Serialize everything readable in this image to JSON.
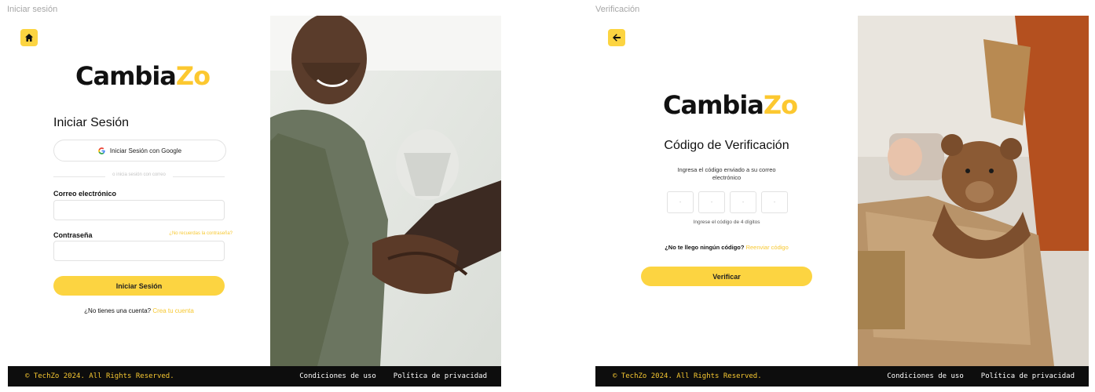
{
  "frames": [
    {
      "label": "Iniciar sesión",
      "logo_main": "Cambia",
      "logo_accent": "Zo",
      "heading": "Iniciar Sesión",
      "google_button": "Iniciar Sesión con Google",
      "divider_text": "o inicia sesión con correo",
      "email_label": "Correo electrónico",
      "email_value": "",
      "password_label": "Contraseña",
      "password_value": "",
      "forgot_link": "¿No recuerdas la contraseña?",
      "submit_button": "Iniciar Sesión",
      "signup_prompt": "¿No tienes una cuenta?",
      "signup_link": "Crea tu cuenta",
      "nav_icon": "home-icon"
    },
    {
      "label": "Verificación",
      "logo_main": "Cambia",
      "logo_accent": "Zo",
      "heading": "Código de Verificación",
      "description": "Ingresa el código enviado a su correo electrónico",
      "code_placeholders": [
        "-",
        "-",
        "-",
        "-"
      ],
      "code_hint": "Ingrese el código de 4 dígitos",
      "resend_prompt": "¿No te llego ningún código?",
      "resend_link": "Reenviar código",
      "submit_button": "Verificar",
      "nav_icon": "arrow-left-icon"
    }
  ],
  "footer": {
    "copyright": "© TechZo 2024. All Rights Reserved.",
    "terms": "Condiciones de uso",
    "privacy": "Política de privacidad"
  },
  "colors": {
    "accent": "#fcd441",
    "accent_text": "#f7c831",
    "footer_bg": "#0d0d0d"
  }
}
